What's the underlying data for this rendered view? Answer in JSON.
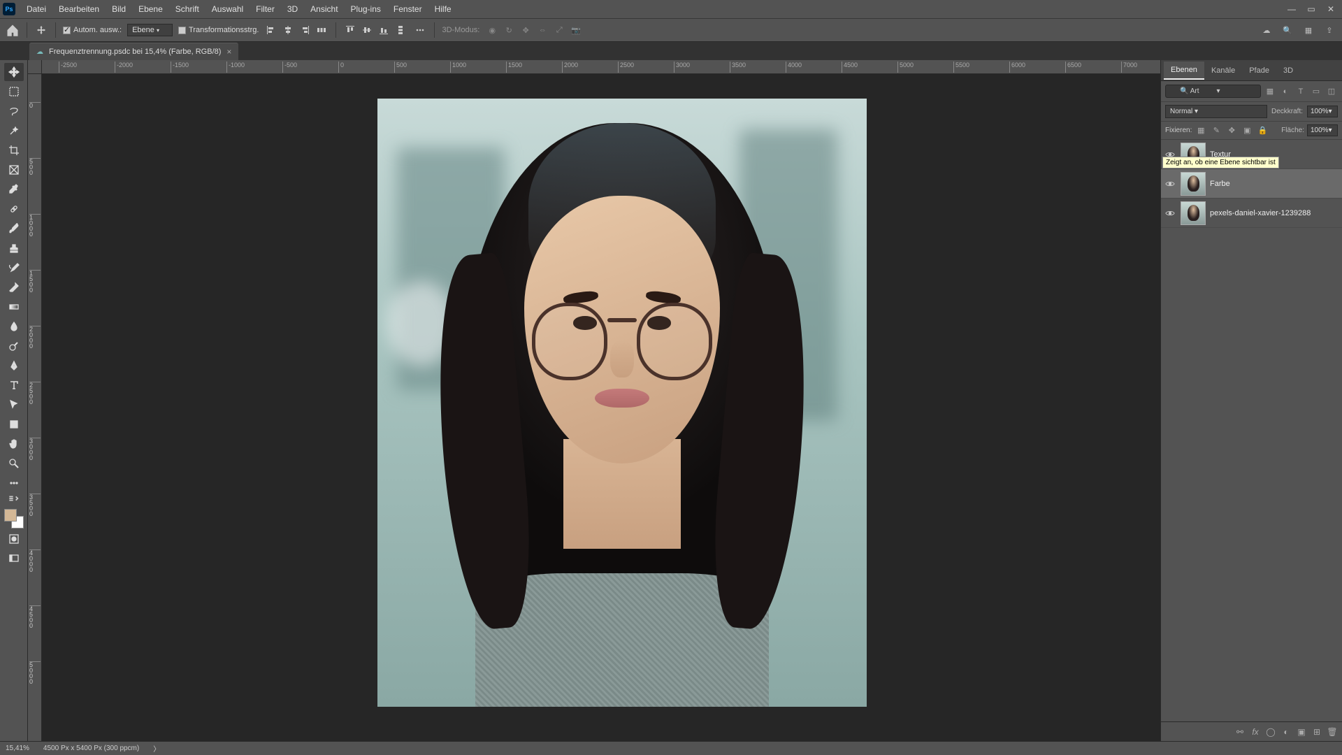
{
  "menu": {
    "items": [
      "Datei",
      "Bearbeiten",
      "Bild",
      "Ebene",
      "Schrift",
      "Auswahl",
      "Filter",
      "3D",
      "Ansicht",
      "Plug-ins",
      "Fenster",
      "Hilfe"
    ]
  },
  "optbar": {
    "auto_select_label": "Autom. ausw.:",
    "auto_select_value": "Ebene",
    "transform_label": "Transformationsstrg.",
    "mode3d_label": "3D-Modus:"
  },
  "doc_tab": {
    "title": "Frequenztrennung.psdc bei 15,4% (Farbe, RGB/8)"
  },
  "ruler_h": [
    "-2500",
    "-2000",
    "-1500",
    "-1000",
    "-500",
    "0",
    "500",
    "1000",
    "1500",
    "2000",
    "2500",
    "3000",
    "3500",
    "4000",
    "4500",
    "5000",
    "5500",
    "6000",
    "6500",
    "7000"
  ],
  "ruler_v": [
    "0",
    "500",
    "1000",
    "1500",
    "2000",
    "2500",
    "3000",
    "3500",
    "4000",
    "4500",
    "5000"
  ],
  "panel": {
    "tabs": [
      "Ebenen",
      "Kanäle",
      "Pfade",
      "3D"
    ],
    "filter_placeholder": "Art",
    "blend_mode": "Normal",
    "opacity_label": "Deckkraft:",
    "opacity_value": "100%",
    "lock_label": "Fixieren:",
    "fill_label": "Fläche:",
    "fill_value": "100%",
    "tooltip": "Zeigt an, ob eine Ebene sichtbar ist",
    "layers": [
      {
        "name": "Textur",
        "visible": true,
        "selected": false,
        "show_tooltip": true
      },
      {
        "name": "Farbe",
        "visible": true,
        "selected": true,
        "show_tooltip": false
      },
      {
        "name": "pexels-daniel-xavier-1239288",
        "visible": true,
        "selected": false,
        "show_tooltip": false
      }
    ]
  },
  "status": {
    "zoom": "15,41%",
    "info": "4500 Px x 5400 Px (300 ppcm)"
  }
}
